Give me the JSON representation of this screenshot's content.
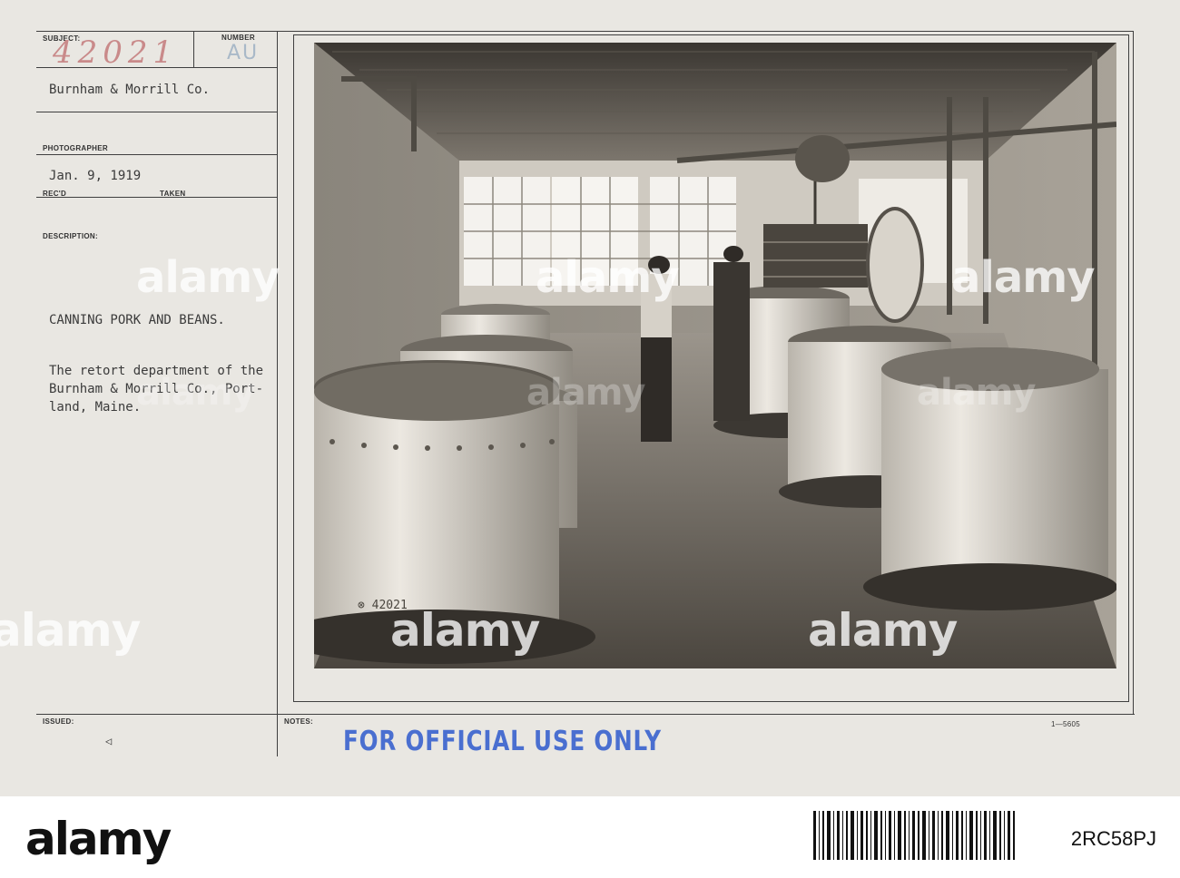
{
  "card": {
    "labels": {
      "subject": "SUBJECT:",
      "number": "NUMBER",
      "photographer": "PHOTOGRAPHER",
      "recd": "REC'D",
      "taken": "TAKEN",
      "description": "DESCRIPTION:",
      "issued": "ISSUED:",
      "notes": "NOTES:"
    },
    "subject_number": "42021",
    "number_code": "AU",
    "company": "Burnham & Morrill Co.",
    "date": "Jan. 9, 1919",
    "caption_title": "CANNING PORK AND BEANS.",
    "caption_lines": [
      "The retort department of the",
      "Burnham & Morrill Co., Port-",
      "land, Maine."
    ],
    "issued_mark": "◁",
    "official_stamp": "FOR OFFICIAL USE ONLY",
    "form_code": "1—5605",
    "photo_stamp": "⊗ 42021"
  },
  "watermark": "alamy",
  "footer": {
    "logo": "alamy",
    "image_id": "2RC58PJ"
  }
}
